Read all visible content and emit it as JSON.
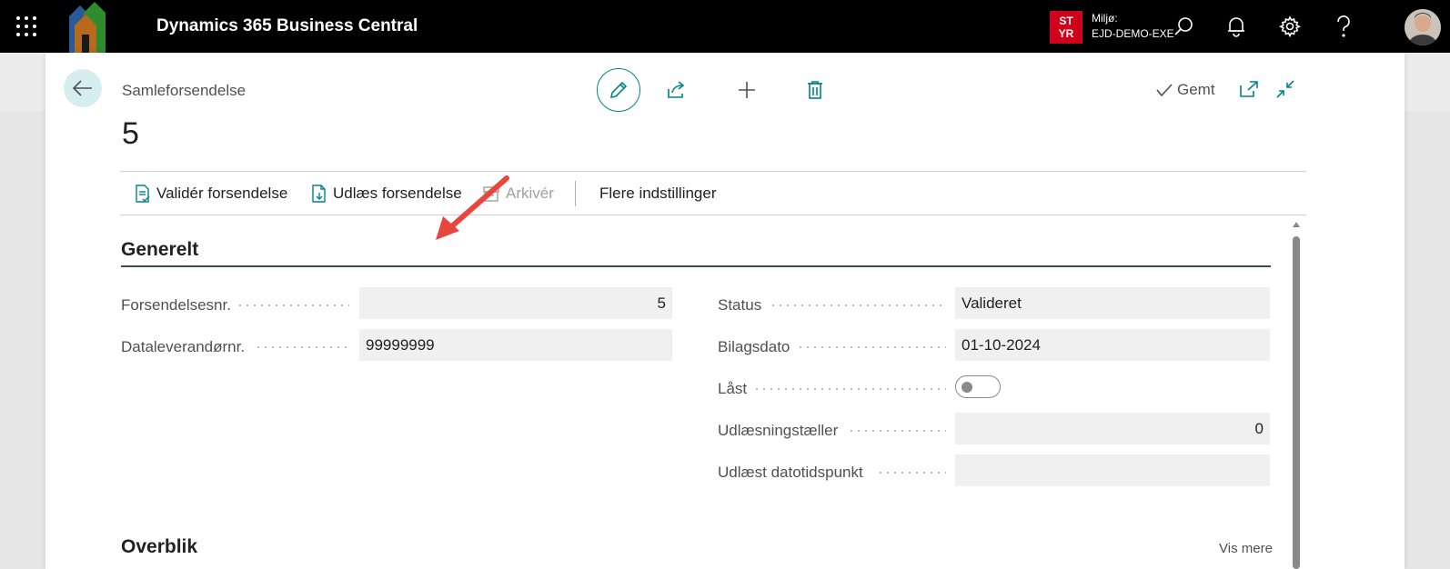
{
  "app": {
    "title": "Dynamics 365 Business Central",
    "environment_badge_line1": "ST",
    "environment_badge_line2": "YR",
    "environment_label": "Miljø:",
    "environment_name": "EJD-DEMO-EXE",
    "badge_color": "#d0021b"
  },
  "page": {
    "breadcrumb": "Samleforsendelse",
    "record_no": "5",
    "saved_label": "Gemt"
  },
  "actions": [
    {
      "label": "Validér forsendelse",
      "icon": "validate-doc-icon",
      "enabled": true
    },
    {
      "label": "Udlæs forsendelse",
      "icon": "export-doc-icon",
      "enabled": true
    },
    {
      "label": "Arkivér",
      "icon": "archive-icon",
      "enabled": false
    },
    {
      "label": "Flere indstillinger",
      "icon": "",
      "enabled": true
    }
  ],
  "general": {
    "title": "Generelt",
    "left_fields": [
      {
        "label": "Forsendelsesnr.",
        "value": "5",
        "align": "right"
      },
      {
        "label": "Dataleverandørnr.",
        "value": "99999999",
        "align": "left"
      }
    ],
    "right_fields": [
      {
        "label": "Status",
        "value": "Valideret",
        "align": "left"
      },
      {
        "label": "Bilagsdato",
        "value": "01-10-2024",
        "align": "left"
      },
      {
        "label": "Låst",
        "value": "",
        "type": "toggle",
        "checked": false
      },
      {
        "label": "Udlæsningstæller",
        "value": "0",
        "align": "right"
      },
      {
        "label": "Udlæst datotidspunkt",
        "value": "",
        "align": "left"
      }
    ]
  },
  "overview": {
    "title": "Overblik",
    "more_link": "Vis mere"
  },
  "colors": {
    "accent": "#008489",
    "annotation_arrow": "#e8453c"
  }
}
